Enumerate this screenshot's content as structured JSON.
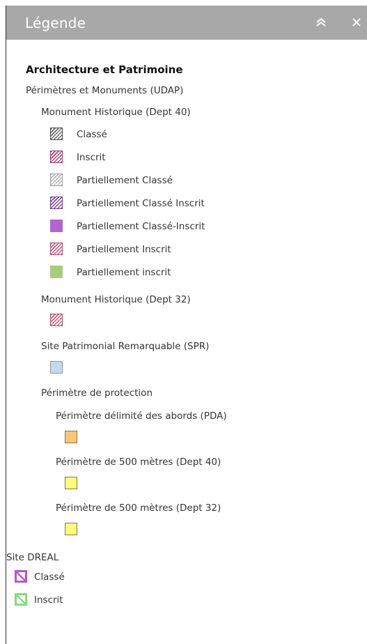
{
  "header": {
    "title": "Légende"
  },
  "legend": {
    "layer": "Architecture et Patrimoine",
    "group_udap": "Périmètres et Monuments (UDAP)",
    "mh40": {
      "label": "Monument Historique (Dept 40)",
      "items": [
        {
          "label": "Classé",
          "symbol": "hatch-dark"
        },
        {
          "label": "Inscrit",
          "symbol": "hatch-pink"
        },
        {
          "label": "Partiellement Classé",
          "symbol": "hatch-grey"
        },
        {
          "label": "Partiellement Classé Inscrit",
          "symbol": "hatch-purple"
        },
        {
          "label": "Partiellement Classé-Inscrit",
          "symbol": "solid-purple"
        },
        {
          "label": "Partiellement Inscrit",
          "symbol": "hatch-rose"
        },
        {
          "label": "Partiellement inscrit",
          "symbol": "solid-green"
        }
      ]
    },
    "mh32": {
      "label": "Monument Historique (Dept 32)"
    },
    "spr": {
      "label": "Site Patrimonial Remarquable (SPR)"
    },
    "protection": {
      "label": "Périmètre de protection",
      "pda": "Périmètre délimité des abords (PDA)",
      "p500_40": "Périmètre de 500 mètres (Dept 40)",
      "p500_32": "Périmètre de 500 mètres (Dept 32)"
    },
    "dreal": {
      "label": "Site DREAL",
      "classe": "Classé",
      "inscrit": "Inscrit"
    }
  },
  "colors": {
    "header_bg": "#a8a8a8",
    "dreal_classe": "#b654d6",
    "dreal_inscrit": "#7fe07a"
  },
  "icons": [
    "double-chevron-up-icon",
    "close-icon"
  ]
}
